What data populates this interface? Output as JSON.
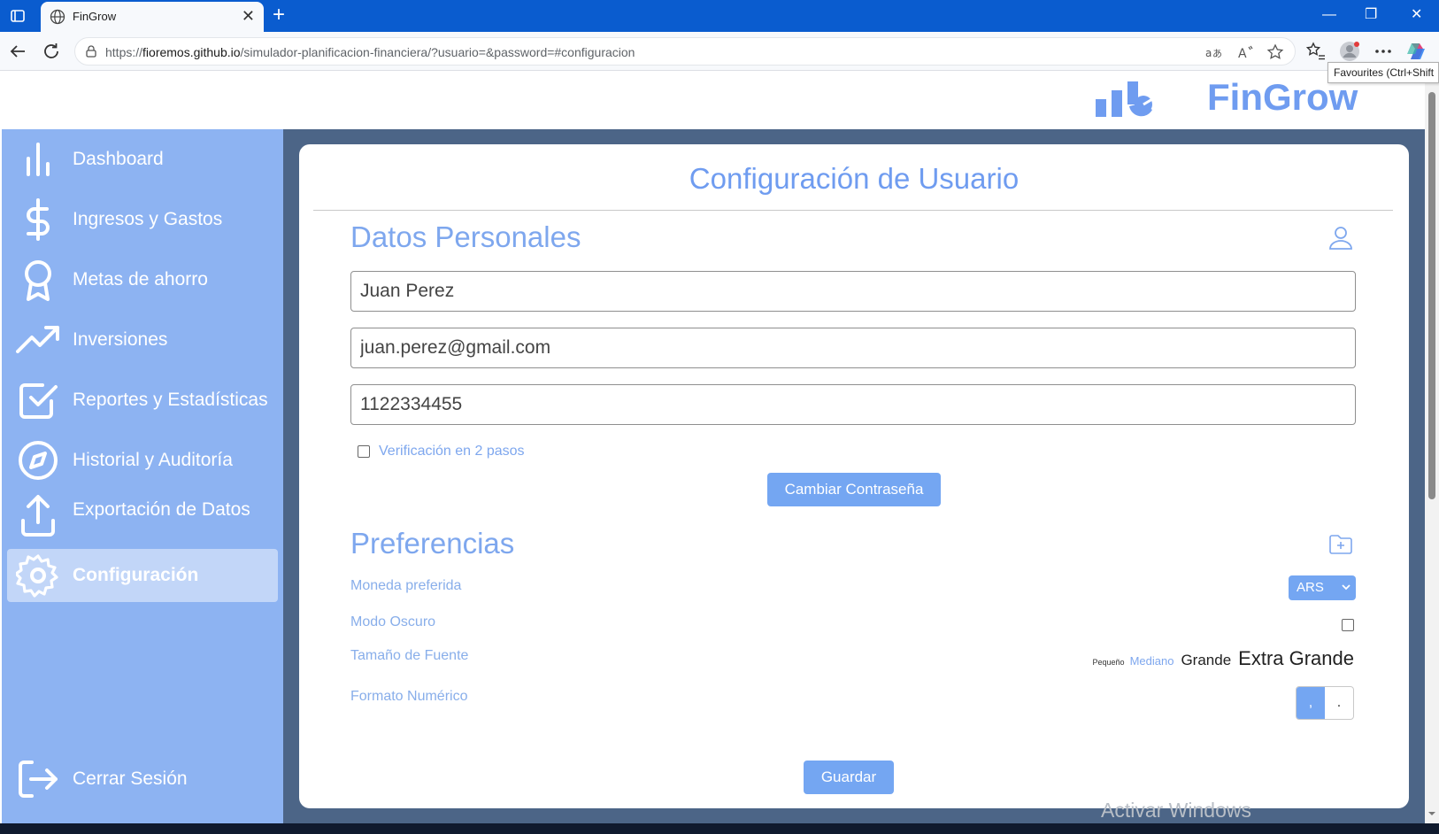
{
  "browser": {
    "tab_title": "FinGrow",
    "tab_close": "✕",
    "new_tab": "+",
    "url_prefix": "https://",
    "url_host": "fioremos.github.io",
    "url_path": "/simulador-planificacion-financiera/?usuario=&password=#configuracion",
    "tooltip": "Favourites (Ctrl+Shift",
    "controls": {
      "minimize": "—",
      "restore": "❐",
      "close": "✕"
    }
  },
  "brand": {
    "name": "FinGrow",
    "color": "#6f9cf0"
  },
  "sidebar": {
    "items": [
      {
        "label": "Dashboard",
        "icon": "bar-chart-icon"
      },
      {
        "label": "Ingresos y Gastos",
        "icon": "dollar-icon"
      },
      {
        "label": "Metas de ahorro",
        "icon": "award-icon"
      },
      {
        "label": "Inversiones",
        "icon": "trending-up-icon"
      },
      {
        "label": "Reportes y Estadísticas",
        "icon": "check-square-icon"
      },
      {
        "label": "Historial y Auditoría",
        "icon": "compass-icon"
      },
      {
        "label": "Exportación de Datos",
        "icon": "upload-icon"
      },
      {
        "label": "Configuración",
        "icon": "gear-icon",
        "active": true
      }
    ],
    "logout": {
      "label": "Cerrar Sesión",
      "icon": "logout-icon"
    },
    "background": "#8db3f2"
  },
  "page": {
    "title": "Configuración de Usuario"
  },
  "personal": {
    "title": "Datos Personales",
    "name_value": "Juan Perez",
    "email_value": "juan.perez@gmail.com",
    "phone_value": "1122334455",
    "two_step_label": "Verificación en 2 pasos",
    "change_password_label": "Cambiar Contraseña"
  },
  "preferences": {
    "title": "Preferencias",
    "currency_label": "Moneda preferida",
    "currency_value": "ARS",
    "dark_mode_label": "Modo Oscuro",
    "font_size_label": "Tamaño de Fuente",
    "font_sizes": {
      "small": "Pequeño",
      "medium": "Mediano",
      "large": "Grande",
      "xlarge": "Extra Grande"
    },
    "number_format_label": "Formato Numérico",
    "number_format_options": {
      "comma": ",",
      "dot": "."
    },
    "save_label": "Guardar"
  },
  "watermark": "Activar Windows",
  "colors": {
    "accent": "#74a6f2",
    "main_bg": "#4c6587",
    "text_accent": "#7ea7ee"
  }
}
